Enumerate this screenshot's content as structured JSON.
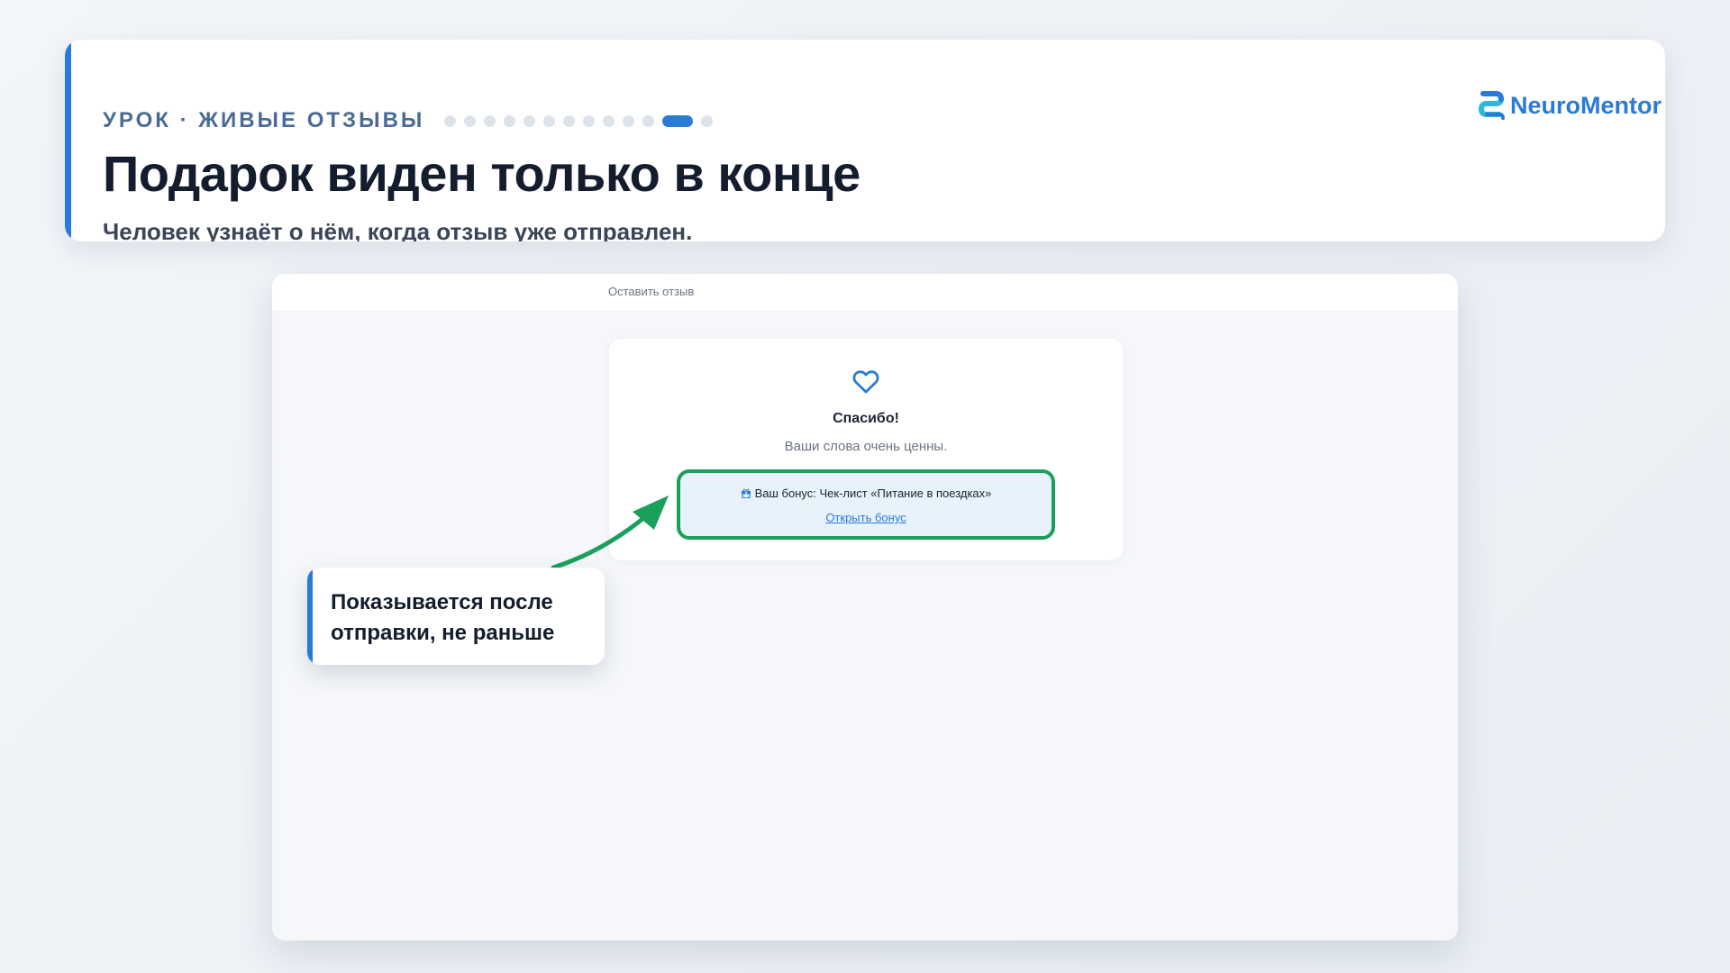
{
  "header": {
    "eyebrow": "УРОК · ЖИВЫЕ ОТЗЫВЫ",
    "progress": {
      "total": 13,
      "current": 12
    },
    "title": "Подарок виден только в конце",
    "subtitle": "Человек узнаёт о нём, когда отзыв уже отправлен."
  },
  "brand": {
    "name": "NeuroMentor",
    "icon": "neuromentor-logo-icon"
  },
  "browser": {
    "title": "Оставить отзыв",
    "card": {
      "icon": "heart-icon",
      "title": "Спасибо!",
      "text": "Ваши слова очень ценны.",
      "bonus": {
        "icon": "gift-icon",
        "label": "Ваш бонус: Чек-лист «Питание в поездках»",
        "link": "Открыть бонус"
      }
    }
  },
  "callout": {
    "text": "Показывается после отправки, не раньше"
  },
  "colors": {
    "accent": "#2a7bd6",
    "highlight": "#1aa05a",
    "title": "#131d2e",
    "eyebrow": "#4a6b95"
  }
}
